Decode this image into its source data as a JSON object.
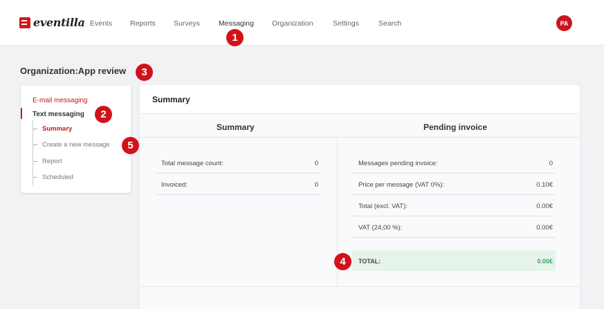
{
  "header": {
    "logo_text": "eventilla",
    "nav": [
      "Events",
      "Reports",
      "Surveys",
      "Messaging",
      "Organization",
      "Settings",
      "Search"
    ],
    "avatar_initials": "PA"
  },
  "markers": [
    "1",
    "2",
    "3",
    "4",
    "5"
  ],
  "page_title": "Organization:App review",
  "sidebar": {
    "email_messaging": "E-mail messaging",
    "text_messaging": "Text messaging",
    "items": [
      "Summary",
      "Create a new message",
      "Report",
      "Scheduled"
    ]
  },
  "card": {
    "title": "Summary",
    "summary": {
      "heading": "Summary",
      "rows": [
        {
          "label": "Total message count:",
          "value": "0"
        },
        {
          "label": "Invoiced:",
          "value": "0"
        }
      ]
    },
    "pending": {
      "heading": "Pending invoice",
      "rows": [
        {
          "label": "Messages pending invoice:",
          "value": "0"
        },
        {
          "label": "Price per message (VAT 0%):",
          "value": "0.10€"
        },
        {
          "label": "Total (excl. VAT):",
          "value": "0.00€"
        },
        {
          "label": "VAT (24,00 %):",
          "value": "0.00€"
        }
      ],
      "total_label": "TOTAL:",
      "total_value": "0.00€"
    }
  },
  "colors": {
    "accent": "#c8161e",
    "marker": "#d2121a",
    "total_bg": "#e6f3ea",
    "total_value": "#3aa657"
  }
}
